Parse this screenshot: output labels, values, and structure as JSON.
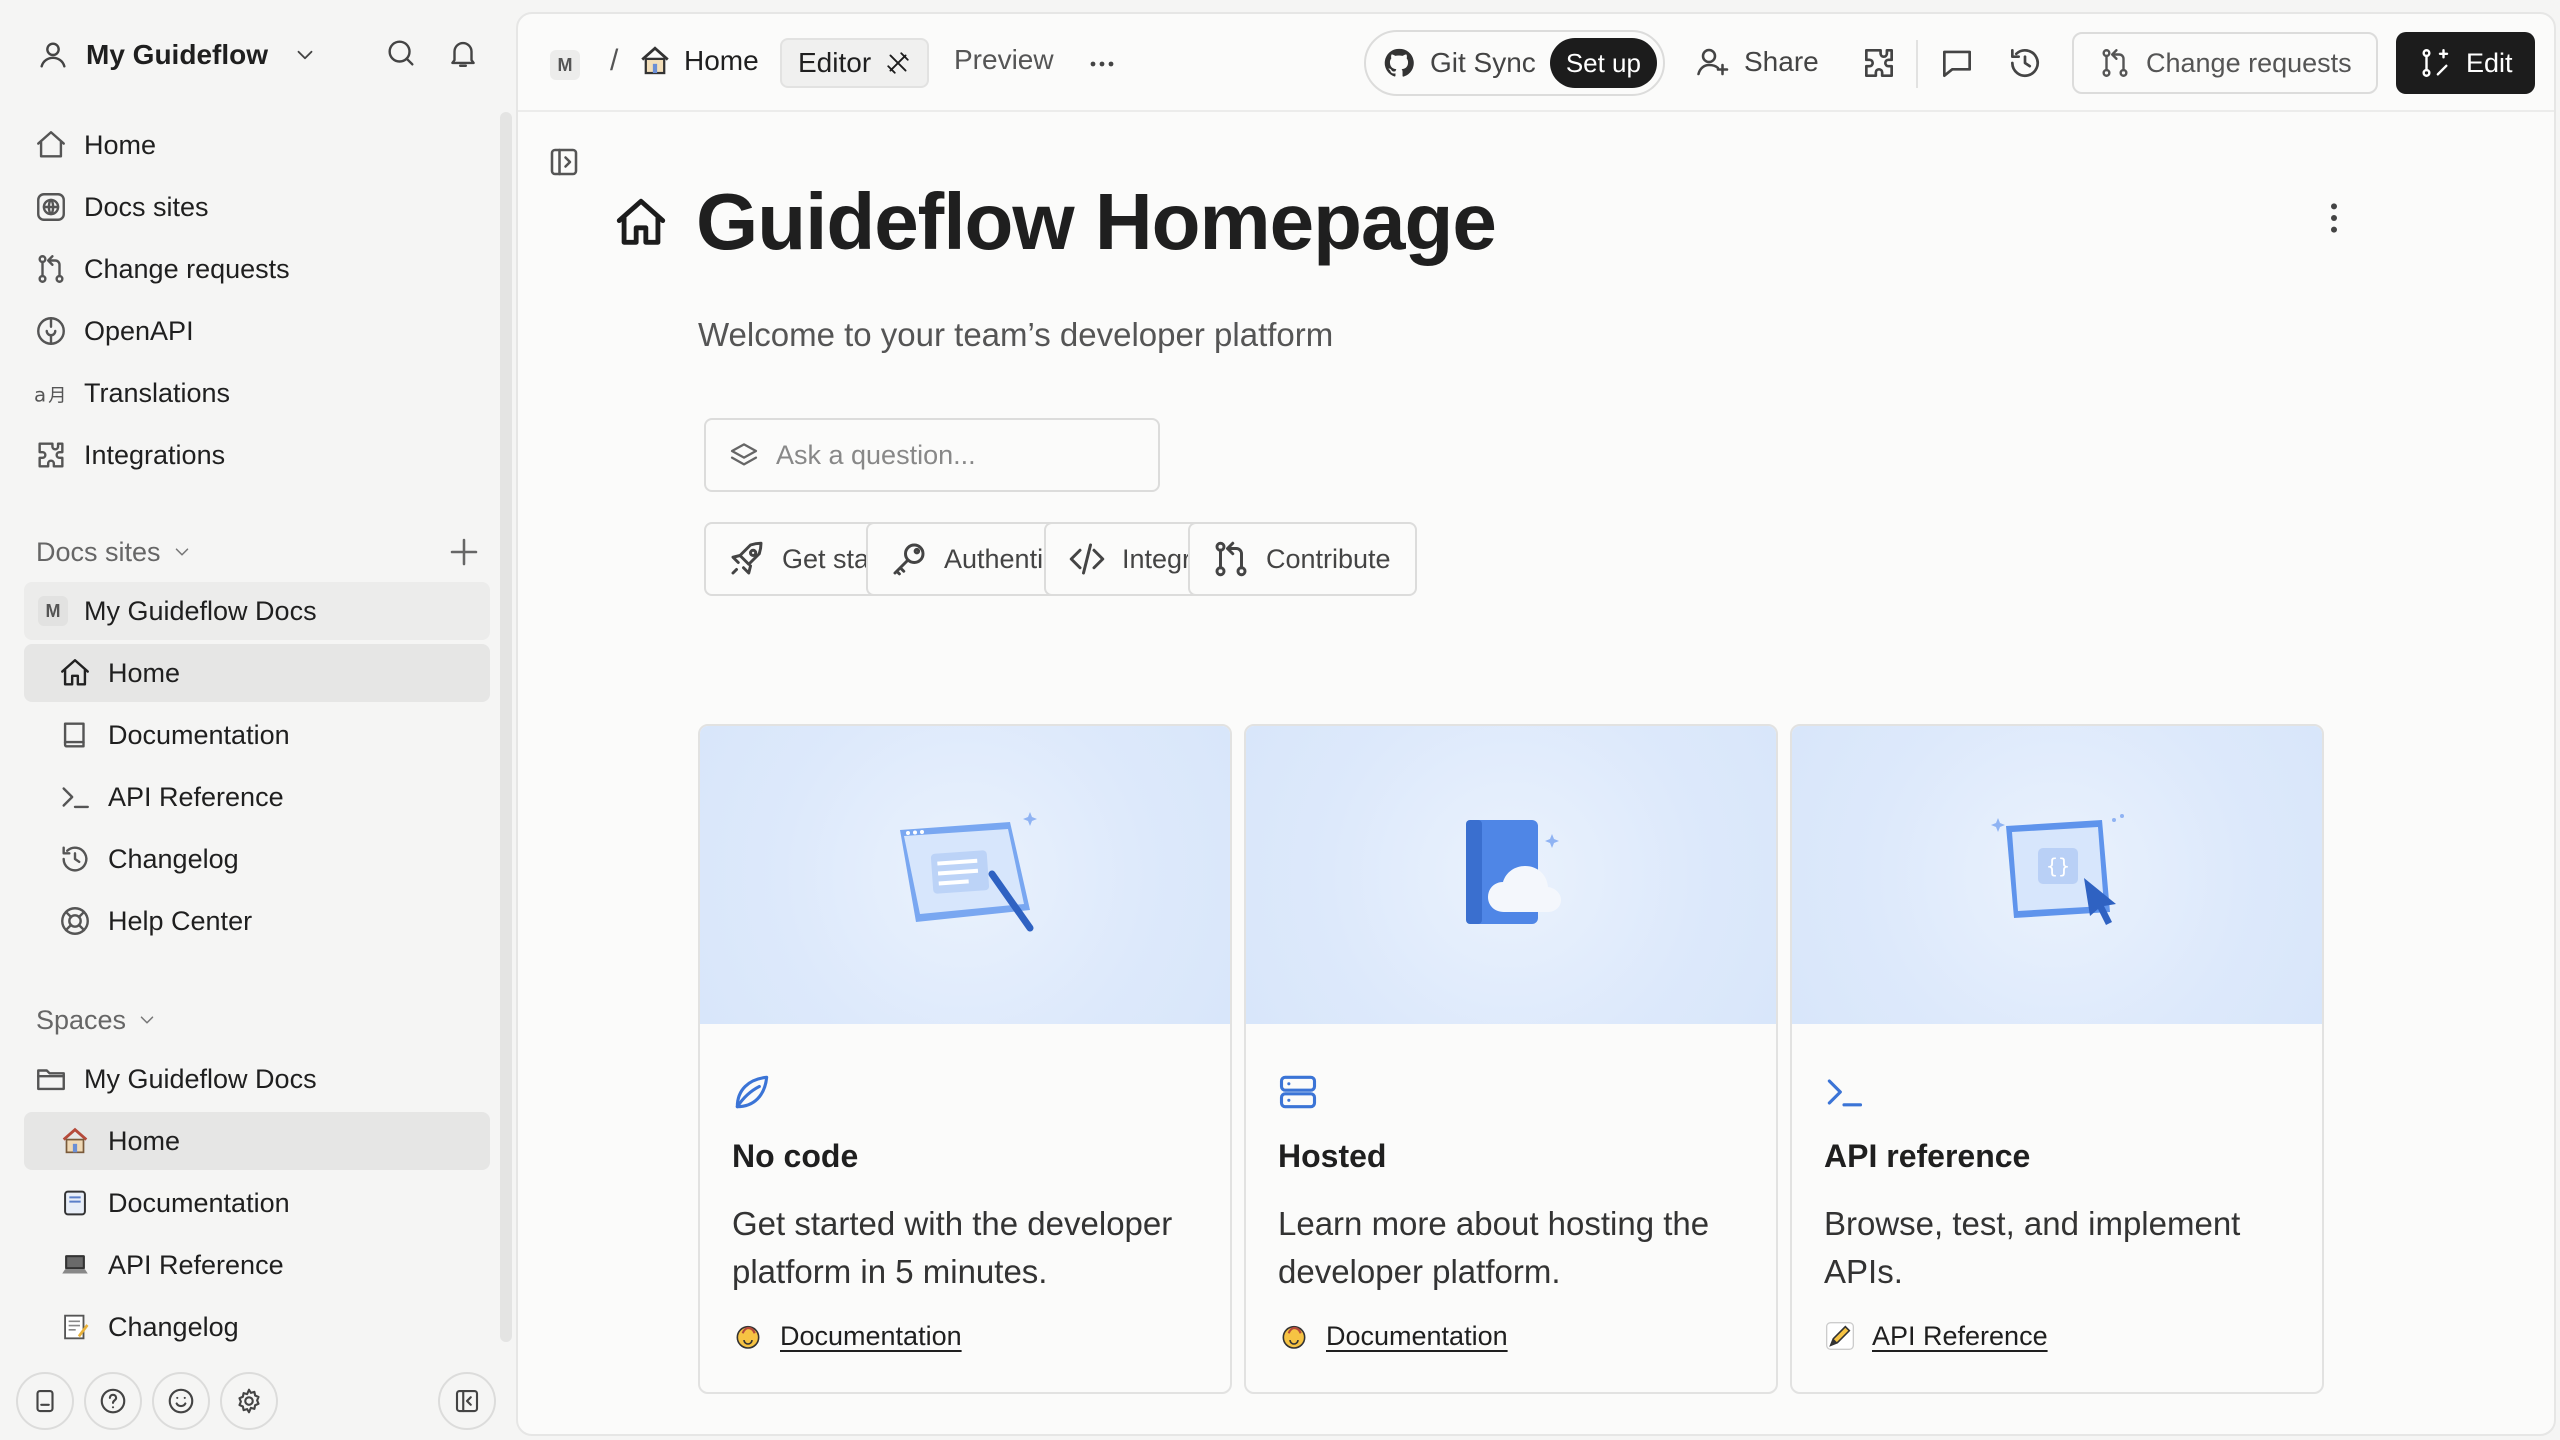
{
  "sidebar": {
    "org_name": "My Guideflow",
    "main_nav": [
      {
        "label": "Home"
      },
      {
        "label": "Docs sites"
      },
      {
        "label": "Change requests"
      },
      {
        "label": "OpenAPI"
      },
      {
        "label": "Translations"
      },
      {
        "label": "Integrations"
      }
    ],
    "docs_sites_header": "Docs sites",
    "docs_site": {
      "badge": "M",
      "name": "My Guideflow Docs"
    },
    "docs_site_pages": [
      {
        "label": "Home"
      },
      {
        "label": "Documentation"
      },
      {
        "label": "API Reference"
      },
      {
        "label": "Changelog"
      },
      {
        "label": "Help Center"
      }
    ],
    "spaces_header": "Spaces",
    "space": {
      "name": "My Guideflow Docs"
    },
    "space_pages": [
      {
        "label": "Home"
      },
      {
        "label": "Documentation"
      },
      {
        "label": "API Reference"
      },
      {
        "label": "Changelog"
      }
    ]
  },
  "topbar": {
    "site_badge": "M",
    "separator": "/",
    "breadcrumb_home": "Home",
    "editor_tab": "Editor",
    "preview_tab": "Preview",
    "git_sync_label": "Git Sync",
    "setup_label": "Set up",
    "share_label": "Share",
    "change_requests_label": "Change requests",
    "edit_label": "Edit"
  },
  "page": {
    "title": "Guideflow Homepage",
    "subtitle": "Welcome to your team’s developer platform",
    "ask_placeholder": "Ask a question...",
    "quick_buttons": [
      {
        "label": "Get started",
        "icon": "rocket-icon"
      },
      {
        "label": "Authenticate",
        "icon": "key-icon"
      },
      {
        "label": "Integrate",
        "icon": "code-icon"
      },
      {
        "label": "Contribute",
        "icon": "git-pull-request-icon"
      }
    ],
    "cards": [
      {
        "title": "No code",
        "description": "Get started with the developer platform in 5 minutes.",
        "link": "Documentation",
        "icon": "leaf-icon"
      },
      {
        "title": "Hosted",
        "description": "Learn more about hosting the developer platform.",
        "link": "Documentation",
        "icon": "server-icon"
      },
      {
        "title": "API reference",
        "description": "Browse, test, and implement APIs.",
        "link": "API Reference",
        "icon": "terminal-icon"
      }
    ]
  },
  "colors": {
    "accent_blue": "#3b74d6",
    "hero_bg": "#dde9fb",
    "primary_button": "#1c1c1c"
  }
}
